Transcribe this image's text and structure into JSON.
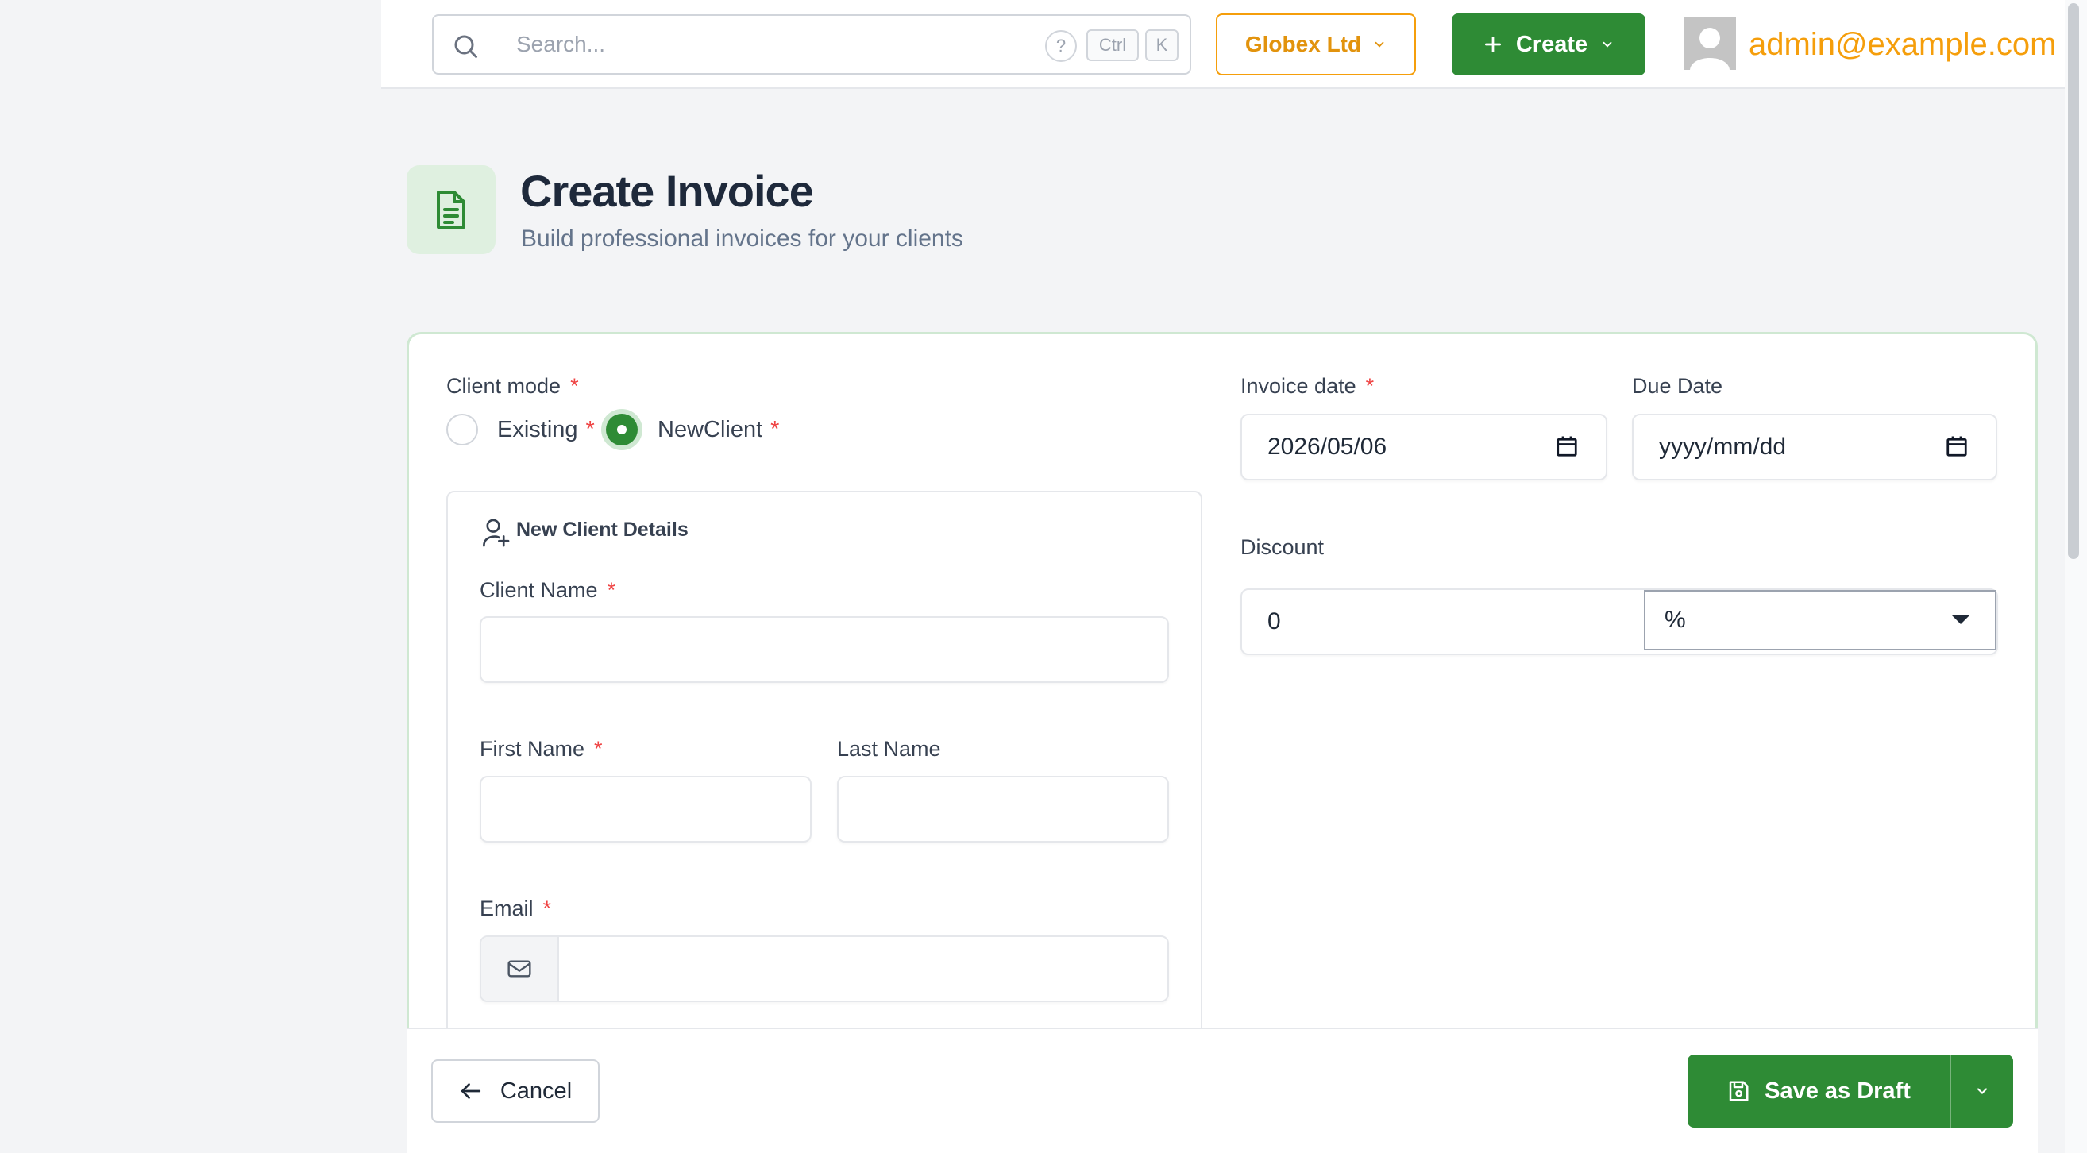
{
  "header": {
    "search_placeholder": "Search...",
    "kbd_ctrl": "Ctrl",
    "kbd_k": "K",
    "company": "Globex Ltd",
    "create_label": "Create",
    "user_email": "admin@example.com"
  },
  "page": {
    "title": "Create Invoice",
    "subtitle": "Build professional invoices for your clients"
  },
  "form": {
    "client_mode_label": "Client mode",
    "client_mode_options": [
      {
        "label": "Existing",
        "checked": false
      },
      {
        "label": "NewClient",
        "checked": true
      }
    ],
    "required_marker": "*",
    "new_client_title": "New Client Details",
    "client_name_label": "Client Name",
    "client_name_value": "",
    "first_name_label": "First Name",
    "first_name_value": "",
    "last_name_label": "Last Name",
    "last_name_value": "",
    "email_label": "Email",
    "email_value": "",
    "invoice_date_label": "Invoice date",
    "invoice_date_value": "2026/05/06",
    "due_date_label": "Due Date",
    "due_date_placeholder": "yyyy/mm/dd",
    "discount_label": "Discount",
    "discount_value": "0",
    "discount_type": "%"
  },
  "footer": {
    "cancel_label": "Cancel",
    "save_draft_label": "Save as Draft"
  },
  "colors": {
    "primary": "#2e8b35",
    "accent": "#f59e0b",
    "required": "#ef4444"
  }
}
